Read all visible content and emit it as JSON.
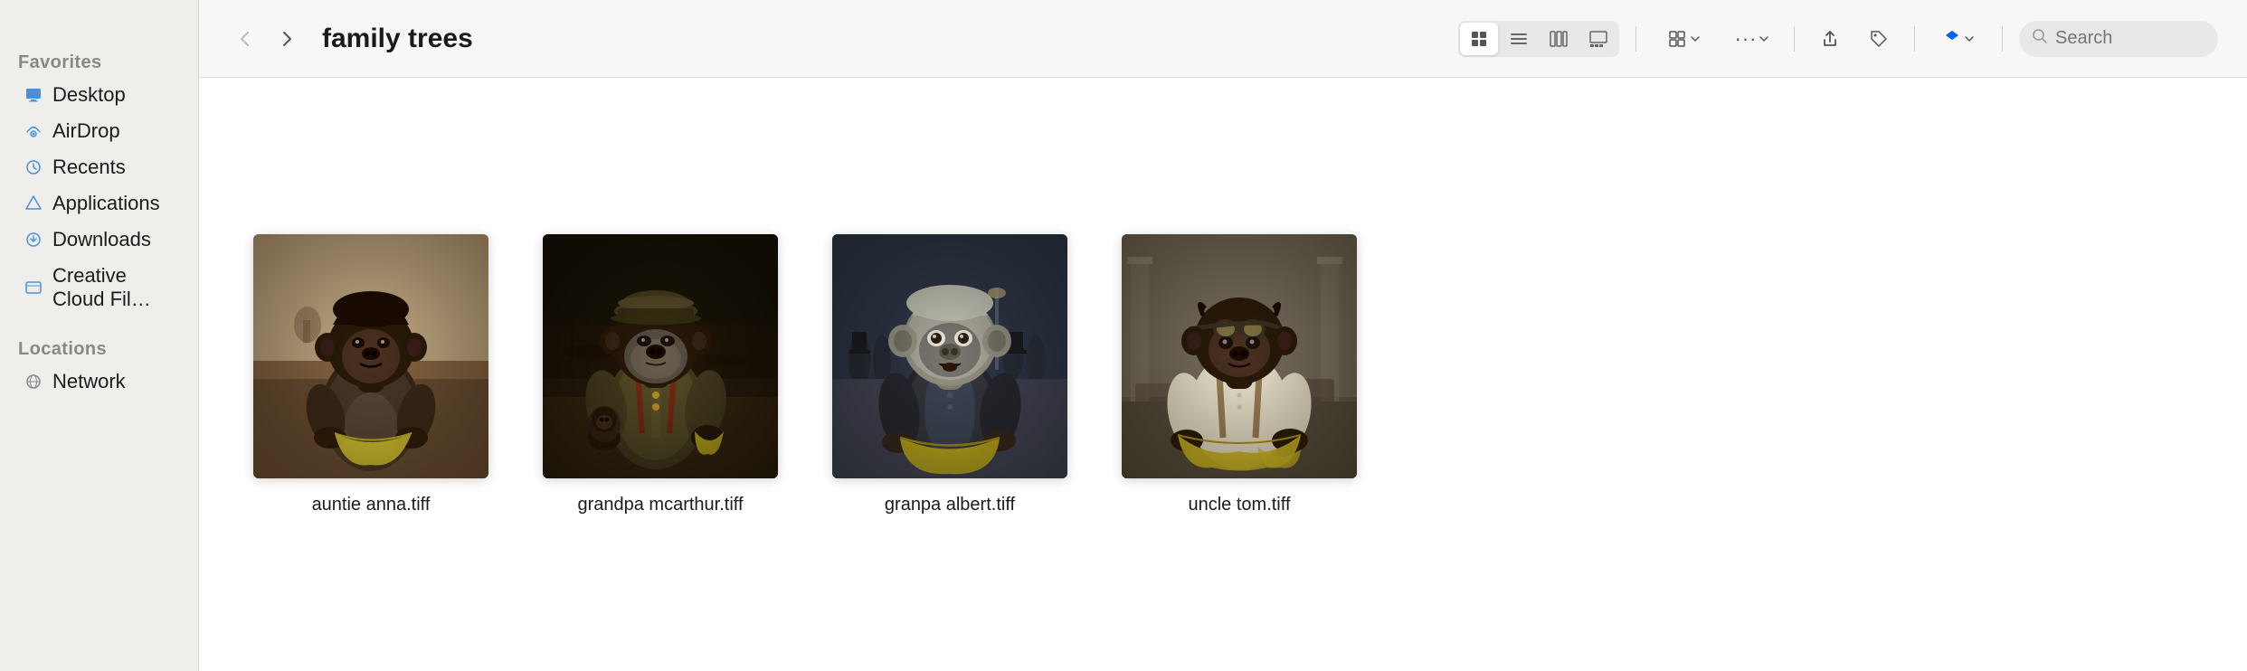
{
  "sidebar": {
    "favorites_label": "Favorites",
    "locations_label": "Locations",
    "items_favorites": [
      {
        "id": "desktop",
        "label": "Desktop",
        "icon": "desktop"
      },
      {
        "id": "airdrop",
        "label": "AirDrop",
        "icon": "airdrop"
      },
      {
        "id": "recents",
        "label": "Recents",
        "icon": "recents"
      },
      {
        "id": "applications",
        "label": "Applications",
        "icon": "applications"
      },
      {
        "id": "downloads",
        "label": "Downloads",
        "icon": "downloads"
      },
      {
        "id": "creative-cloud",
        "label": "Creative Cloud Fil…",
        "icon": "creative-cloud"
      }
    ],
    "items_locations": [
      {
        "id": "network",
        "label": "Network",
        "icon": "network"
      }
    ]
  },
  "toolbar": {
    "back_label": "‹",
    "forward_label": "›",
    "folder_title": "family trees",
    "view_icon": "⊞",
    "view_list_icon": "☰",
    "view_columns_icon": "⊟",
    "view_gallery_icon": "⊡",
    "group_icon": "⊞",
    "more_icon": "…",
    "share_icon": "↑",
    "tag_icon": "◇",
    "dropbox_icon": "◆",
    "search_placeholder": "Search"
  },
  "files": [
    {
      "id": "auntie-anna",
      "label": "auntie anna.tiff",
      "img_class": "img-auntie"
    },
    {
      "id": "grandpa-mcarthur",
      "label": "grandpa mcarthur.tiff",
      "img_class": "img-grandpa"
    },
    {
      "id": "granpa-albert",
      "label": "granpa albert.tiff",
      "img_class": "img-granpa"
    },
    {
      "id": "uncle-tom",
      "label": "uncle tom.tiff",
      "img_class": "img-uncle"
    }
  ]
}
